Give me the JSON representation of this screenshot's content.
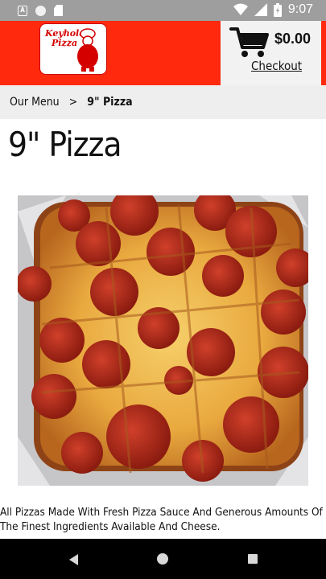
{
  "status_bar": {
    "time": "9:07",
    "left_icons": [
      "a-notification-icon",
      "circle-notification-icon",
      "sd-card-icon"
    ],
    "right_icons": [
      "wifi-icon",
      "signal-icon",
      "battery-icon"
    ]
  },
  "header": {
    "logo_line1": "Keyhole",
    "logo_line2": "Pizza",
    "cart_total": "$0.00",
    "checkout_label": "Checkout",
    "brand_color": "#ff2a0e"
  },
  "breadcrumb": {
    "home": "Our Menu",
    "separator": ">",
    "current": "9\" Pizza"
  },
  "product": {
    "title": "9\" Pizza",
    "image_alt": "pepperoni pizza photo",
    "description": "All Pizzas Made With Fresh Pizza Sauce And Generous Amounts Of The Finest Ingredients Available And Cheese."
  },
  "nav_bar": {
    "buttons": [
      "back-icon",
      "home-icon",
      "recents-icon"
    ]
  }
}
